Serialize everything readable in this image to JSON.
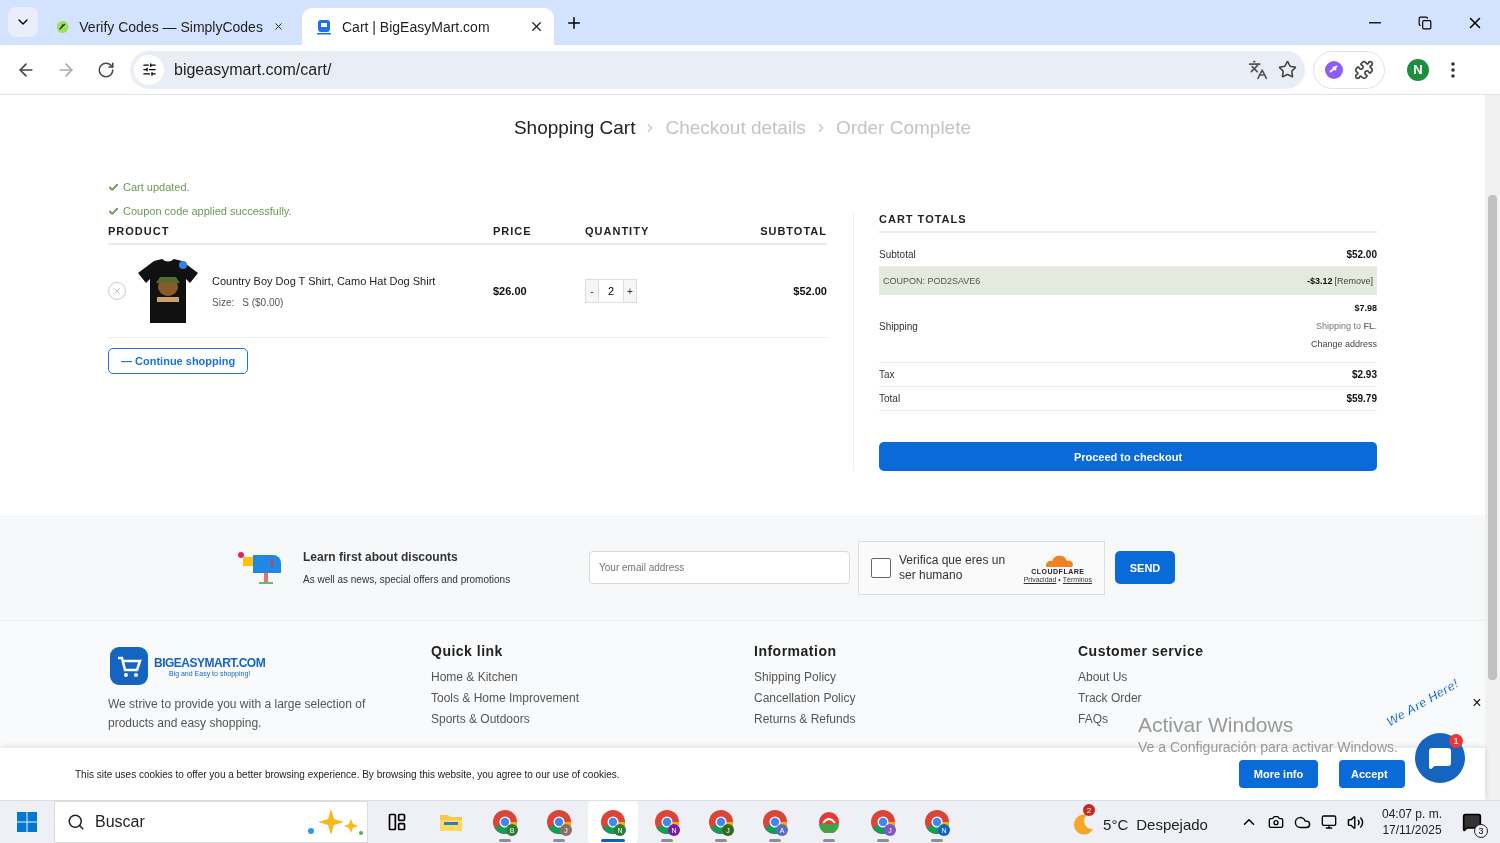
{
  "browser": {
    "tabs": [
      {
        "title": "Verify Codes — SimplyCodes",
        "kind": "simplycodes",
        "selected": false
      },
      {
        "title": "Cart | BigEasyMart.com",
        "kind": "bigeasymart",
        "selected": true
      }
    ],
    "nav": {
      "back_disabled": false,
      "forward_disabled": true
    },
    "url": "bigeasymart.com/cart/",
    "profile": "N"
  },
  "breadcrumb": [
    {
      "label": "Shopping Cart",
      "selected": true
    },
    {
      "label": "Checkout details",
      "selected": false
    },
    {
      "label": "Order Complete",
      "selected": false
    }
  ],
  "notices": [
    "Cart updated.",
    "Coupon code applied successfully."
  ],
  "cart": {
    "columns": [
      "PRODUCT",
      "PRICE",
      "QUANTITY",
      "SUBTOTAL"
    ],
    "rows": [
      {
        "name": "Country Boy Dog T Shirt, Camo Hat Dog Shirt",
        "size_label": "Size:",
        "size_value": "S ($0.00)",
        "price": "$26.00",
        "qty_minus": "-",
        "quantity": "2",
        "qty_plus": "+",
        "subtotal": "$52.00"
      }
    ],
    "continue": "— Continue shopping"
  },
  "totals": {
    "title": "CART TOTALS",
    "rows": [
      {
        "kind": "plain",
        "label": "Subtotal",
        "value": "$52.00"
      },
      {
        "kind": "coupon",
        "label": "COUPON: POD2SAVE6",
        "value": "-$3.12",
        "action": "[Remove]"
      },
      {
        "kind": "shipping",
        "label": "Shipping",
        "value": "$7.98",
        "note": "Shipping to **FL**.",
        "action": "Change address"
      },
      {
        "kind": "plain",
        "label": "Tax",
        "value": "$2.93"
      },
      {
        "kind": "plain",
        "label": "Total",
        "value": "$59.79"
      }
    ],
    "checkout": "Proceed to checkout"
  },
  "newsletter": {
    "title": "Learn first about discounts",
    "subtitle": "As well as news, special offers and promotions",
    "placeholder": "Your email address",
    "captcha": {
      "checked": false,
      "label": "Verifica que eres un ser humano",
      "brand": "CLOUDFLARE",
      "links": [
        "Privacidad",
        "•",
        "Términos"
      ]
    },
    "send": "SEND"
  },
  "footer": {
    "logo": "BIGEASYMART.COM",
    "tagline": "Big and Easy to shopping!",
    "about": "We strive to provide you with a large selection of products and easy shopping.",
    "columns": [
      {
        "heading": "Quick link",
        "links": [
          "Home & Kitchen",
          "Tools & Home Improvement",
          "Sports & Outdoors"
        ]
      },
      {
        "heading": "Information",
        "links": [
          "Shipping Policy",
          "Cancellation Policy",
          "Returns & Refunds"
        ]
      },
      {
        "heading": "Customer service",
        "links": [
          "About Us",
          "Track Order",
          "FAQs"
        ]
      }
    ]
  },
  "cookie": {
    "text": "This site uses cookies to offer you a better browsing experience. By browsing this website, you agree to our use of cookies.",
    "more": "More info",
    "accept": "Accept"
  },
  "chat": {
    "caption": "We Are Here!",
    "badge": "1",
    "close": "×"
  },
  "os_notice": {
    "title": "Activar Windows",
    "text": "Ve a Configuración para activar Windows."
  },
  "taskbar": {
    "search": "Buscar",
    "apps": [
      {
        "kind": "files",
        "selected": false
      },
      {
        "kind": "chrome",
        "profile": "B",
        "color": "#2e7d32",
        "selected": false
      },
      {
        "kind": "chrome",
        "profile": "J",
        "color": "#8d6e63",
        "selected": false
      },
      {
        "kind": "chrome",
        "profile": "N",
        "color": "#2e7d32",
        "selected": true
      },
      {
        "kind": "chrome",
        "profile": "N",
        "color": "#7b1fa2",
        "selected": false
      },
      {
        "kind": "chrome",
        "profile": "J",
        "color": "#33691e",
        "selected": false
      },
      {
        "kind": "chrome",
        "profile": "A",
        "color": "#5c6bc0",
        "selected": false
      },
      {
        "kind": "app",
        "selected": false
      },
      {
        "kind": "chrome",
        "profile": "J",
        "color": "#7e57c2",
        "selected": false
      },
      {
        "kind": "chrome",
        "profile": "N",
        "color": "#1565c0",
        "selected": false
      }
    ],
    "weather_badge": "2",
    "weather": "5°C",
    "weather_text": "Despejado",
    "time": "04:07 p. m.",
    "date": "17/11/2025",
    "notifications": "3"
  }
}
